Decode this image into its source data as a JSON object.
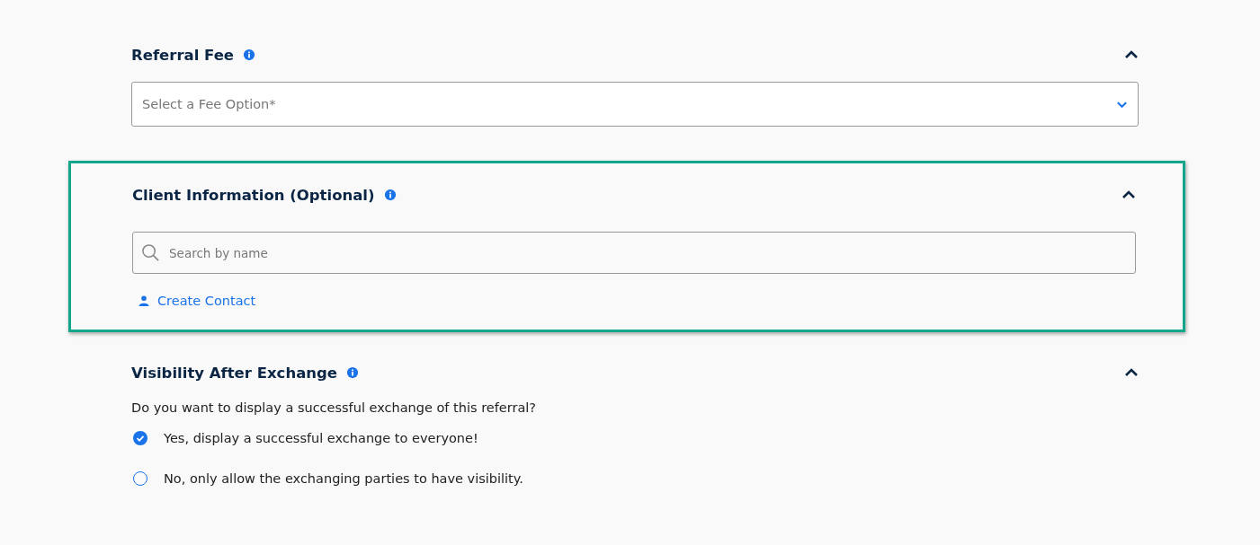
{
  "sections": [
    {
      "kind": "select",
      "title": "Referral Fee",
      "expanded": true,
      "highlighted": false,
      "placeholder": "Select a Fee Option*"
    },
    {
      "kind": "search",
      "title": "Client Information (Optional)",
      "expanded": true,
      "highlighted": true,
      "placeholder": "Search by name",
      "link": "Create Contact"
    },
    {
      "kind": "radio",
      "title": "Visibility After Exchange",
      "expanded": true,
      "highlighted": false,
      "question": "Do you want to display a successful exchange of this referral?",
      "options": [
        {
          "label": "Yes, display a successful exchange to everyone!",
          "selected": true
        },
        {
          "label": "No, only allow the exchanging parties to have visibility.",
          "selected": false
        }
      ]
    }
  ]
}
